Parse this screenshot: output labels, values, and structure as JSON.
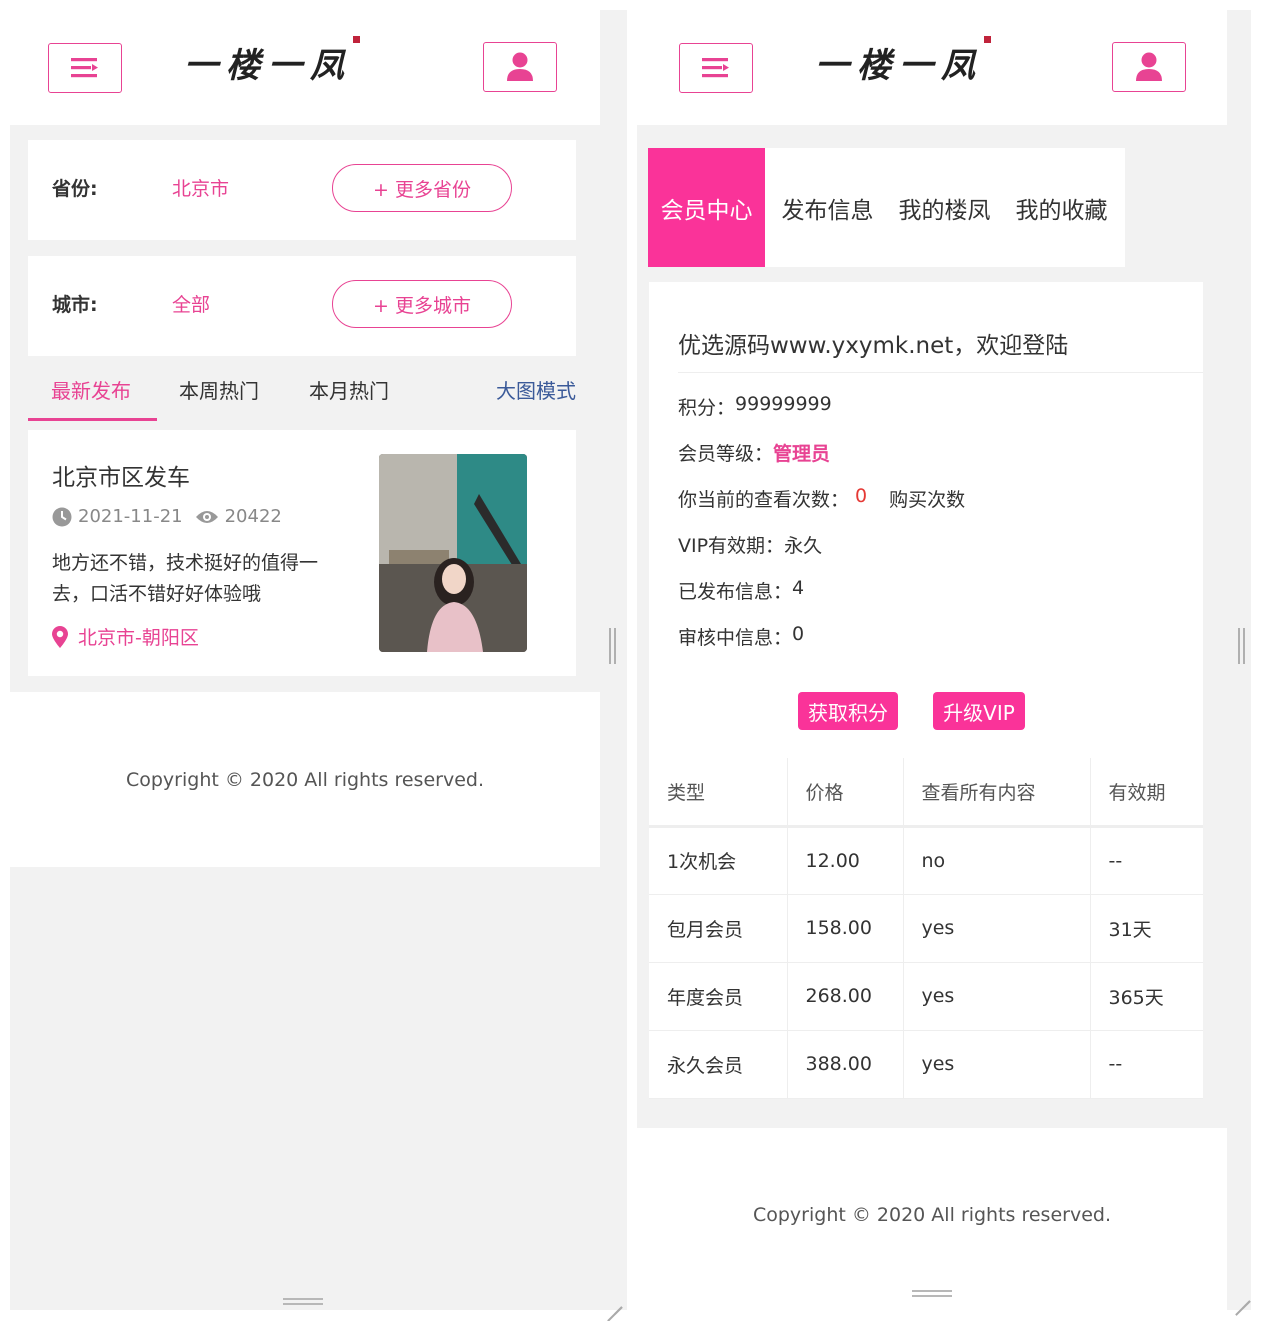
{
  "colors": {
    "accent": "#e84393",
    "tab_active_bg": "#fa3399",
    "link_blue": "#3b5a99",
    "count_red": "#e53935"
  },
  "header": {
    "logo_text": "一楼一凤",
    "menu_icon": "menu-icon",
    "user_icon": "user-icon"
  },
  "left": {
    "province": {
      "label": "省份:",
      "value": "北京市",
      "more": "+ 更多省份"
    },
    "city": {
      "label": "城市:",
      "value": "全部",
      "more": "+ 更多城市"
    },
    "tabs": [
      {
        "label": "最新发布",
        "active": true
      },
      {
        "label": "本周热门",
        "active": false
      },
      {
        "label": "本月热门",
        "active": false
      }
    ],
    "view_mode": "大图模式",
    "post": {
      "title": "北京市区发车",
      "date": "2021-11-21",
      "views": "20422",
      "description": "地方还不错，技术挺好的值得一去，口活不错好好体验哦",
      "location": "北京市-朝阳区"
    },
    "footer": "Copyright © 2020 All rights reserved."
  },
  "right": {
    "tabs": [
      {
        "label": "会员中心",
        "active": true
      },
      {
        "label": "发布信息",
        "active": false
      },
      {
        "label": "我的楼凤",
        "active": false
      },
      {
        "label": "我的收藏",
        "active": false
      }
    ],
    "welcome": "优选源码www.yxymk.net，欢迎登陆",
    "points_label": "积分：",
    "points_value": "99999999",
    "level_label": "会员等级：",
    "level_value": "管理员",
    "views_label": "你当前的查看次数：",
    "views_value": "0",
    "buy_label": "购买次数",
    "vip_label": "VIP有效期：",
    "vip_value": "永久",
    "published_label": "已发布信息：",
    "published_value": "4",
    "pending_label": "审核中信息：",
    "pending_value": "0",
    "get_points_button": "获取积分",
    "upgrade_vip_button": "升级VIP",
    "table": {
      "headers": [
        "类型",
        "价格",
        "查看所有内容",
        "有效期"
      ],
      "rows": [
        [
          "1次机会",
          "12.00",
          "no",
          "--"
        ],
        [
          "包月会员",
          "158.00",
          "yes",
          "31天"
        ],
        [
          "年度会员",
          "268.00",
          "yes",
          "365天"
        ],
        [
          "永久会员",
          "388.00",
          "yes",
          "--"
        ]
      ]
    },
    "footer": "Copyright © 2020 All rights reserved."
  }
}
